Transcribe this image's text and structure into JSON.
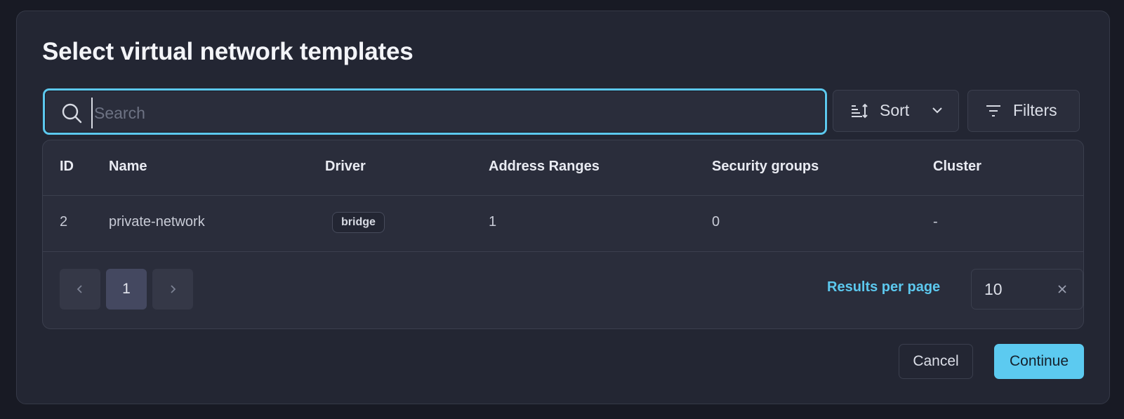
{
  "dialog": {
    "title": "Select virtual network templates"
  },
  "search": {
    "placeholder": "Search",
    "value": ""
  },
  "toolbar": {
    "sort_label": "Sort",
    "filters_label": "Filters"
  },
  "table": {
    "columns": [
      "ID",
      "Name",
      "Driver",
      "Address Ranges",
      "Security groups",
      "Cluster"
    ],
    "rows": [
      {
        "id": "2",
        "name": "private-network",
        "driver": "bridge",
        "address_ranges": "1",
        "security_groups": "0",
        "cluster": "-"
      }
    ]
  },
  "pagination": {
    "current_page": "1",
    "results_per_page_label": "Results per page",
    "results_per_page_value": "10"
  },
  "footer": {
    "cancel_label": "Cancel",
    "continue_label": "Continue"
  },
  "colors": {
    "accent": "#5ccaf0",
    "background": "#232633",
    "surface": "#2a2d3b"
  }
}
